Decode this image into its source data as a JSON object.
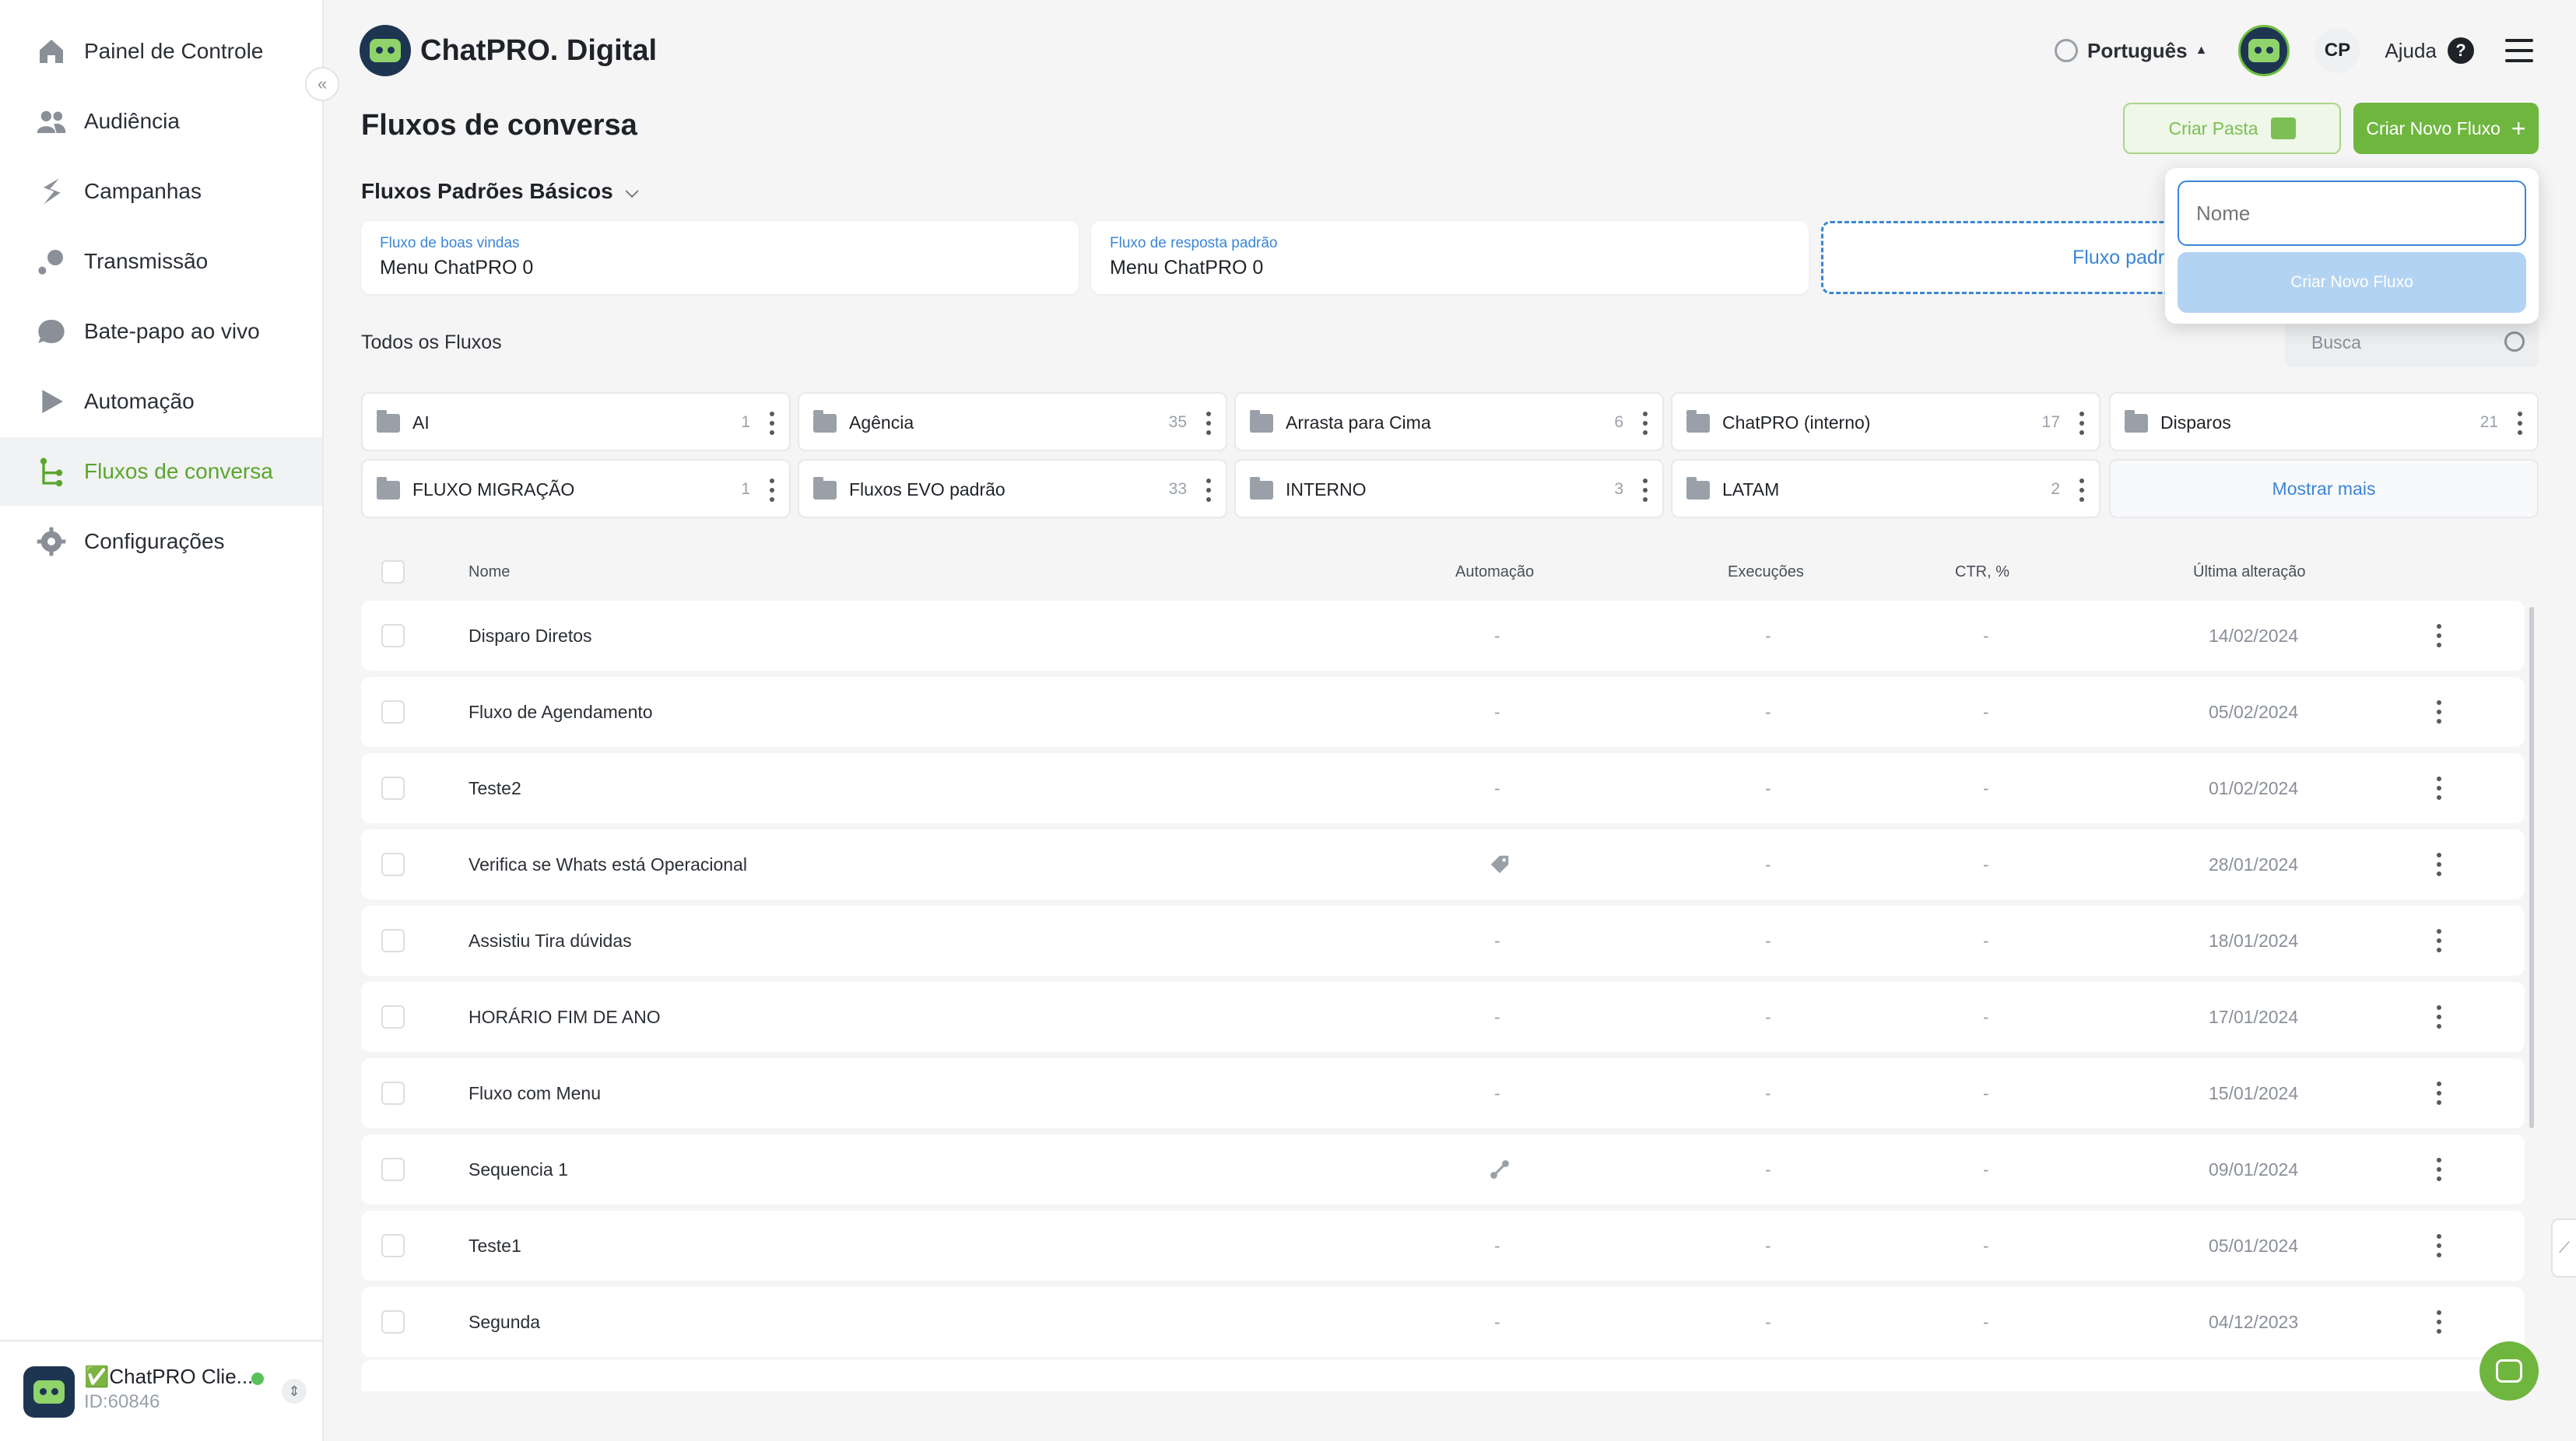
{
  "sidebar": {
    "items": [
      {
        "label": "Painel de Controle",
        "icon": "home-icon"
      },
      {
        "label": "Audiência",
        "icon": "users-icon"
      },
      {
        "label": "Campanhas",
        "icon": "lightning-icon"
      },
      {
        "label": "Transmissão",
        "icon": "broadcast-icon"
      },
      {
        "label": "Bate-papo ao vivo",
        "icon": "chat-bubble-icon"
      },
      {
        "label": "Automação",
        "icon": "automation-icon"
      },
      {
        "label": "Fluxos de conversa",
        "icon": "flow-icon"
      },
      {
        "label": "Configurações",
        "icon": "gear-icon"
      }
    ],
    "active_index": 6,
    "account": {
      "name": "✅ChatPRO Clie...",
      "id": "ID:60846"
    }
  },
  "header": {
    "brand": "ChatPRO. Digital",
    "language": "Português",
    "initials": "CP",
    "help": "Ajuda"
  },
  "page": {
    "title": "Fluxos de conversa",
    "create_folder_label": "Criar Pasta",
    "create_flow_label": "Criar Novo Fluxo"
  },
  "defaults": {
    "section_title": "Fluxos Padrões Básicos",
    "cards": [
      {
        "label": "Fluxo de boas vindas",
        "value": "Menu ChatPRO 0"
      },
      {
        "label": "Fluxo de resposta padrão",
        "value": "Menu ChatPRO 0"
      }
    ],
    "dashed_card": "Fluxo padr"
  },
  "all_flows": {
    "title": "Todos os Fluxos",
    "search_placeholder": "Busca"
  },
  "folders": [
    {
      "name": "AI",
      "count": "1"
    },
    {
      "name": "Agência",
      "count": "35"
    },
    {
      "name": "Arrasta para Cima",
      "count": "6"
    },
    {
      "name": "ChatPRO (interno)",
      "count": "17"
    },
    {
      "name": "Disparos",
      "count": "21"
    },
    {
      "name": "FLUXO MIGRAÇÃO",
      "count": "1"
    },
    {
      "name": "Fluxos EVO padrão",
      "count": "33"
    },
    {
      "name": "INTERNO",
      "count": "3"
    },
    {
      "name": "LATAM",
      "count": "2"
    }
  ],
  "show_more": "Mostrar mais",
  "table": {
    "columns": [
      "Nome",
      "Automação",
      "Execuções",
      "CTR, %",
      "Última alteração"
    ],
    "rows": [
      {
        "name": "Disparo Diretos",
        "automation": "-",
        "executions": "-",
        "ctr": "-",
        "date": "14/02/2024"
      },
      {
        "name": "Fluxo de Agendamento",
        "automation": "-",
        "executions": "-",
        "ctr": "-",
        "date": "05/02/2024"
      },
      {
        "name": "Teste2",
        "automation": "-",
        "executions": "-",
        "ctr": "-",
        "date": "01/02/2024"
      },
      {
        "name": "Verifica se Whats está Operacional",
        "automation": "tag-icon",
        "executions": "-",
        "ctr": "-",
        "date": "28/01/2024"
      },
      {
        "name": "Assistiu Tira dúvidas",
        "automation": "-",
        "executions": "-",
        "ctr": "-",
        "date": "18/01/2024"
      },
      {
        "name": "HORÁRIO FIM DE ANO",
        "automation": "-",
        "executions": "-",
        "ctr": "-",
        "date": "17/01/2024"
      },
      {
        "name": "Fluxo com Menu",
        "automation": "-",
        "executions": "-",
        "ctr": "-",
        "date": "15/01/2024"
      },
      {
        "name": "Sequencia 1",
        "automation": "sequence-icon",
        "executions": "-",
        "ctr": "-",
        "date": "09/01/2024"
      },
      {
        "name": "Teste1",
        "automation": "-",
        "executions": "-",
        "ctr": "-",
        "date": "05/01/2024"
      },
      {
        "name": "Segunda",
        "automation": "-",
        "executions": "-",
        "ctr": "-",
        "date": "04/12/2023"
      }
    ]
  },
  "popup": {
    "placeholder": "Nome",
    "button_label": "Criar Novo Fluxo"
  },
  "colors": {
    "accent": "#6fb63f",
    "link": "#3a86d6",
    "brand_dark": "#1e3552"
  }
}
